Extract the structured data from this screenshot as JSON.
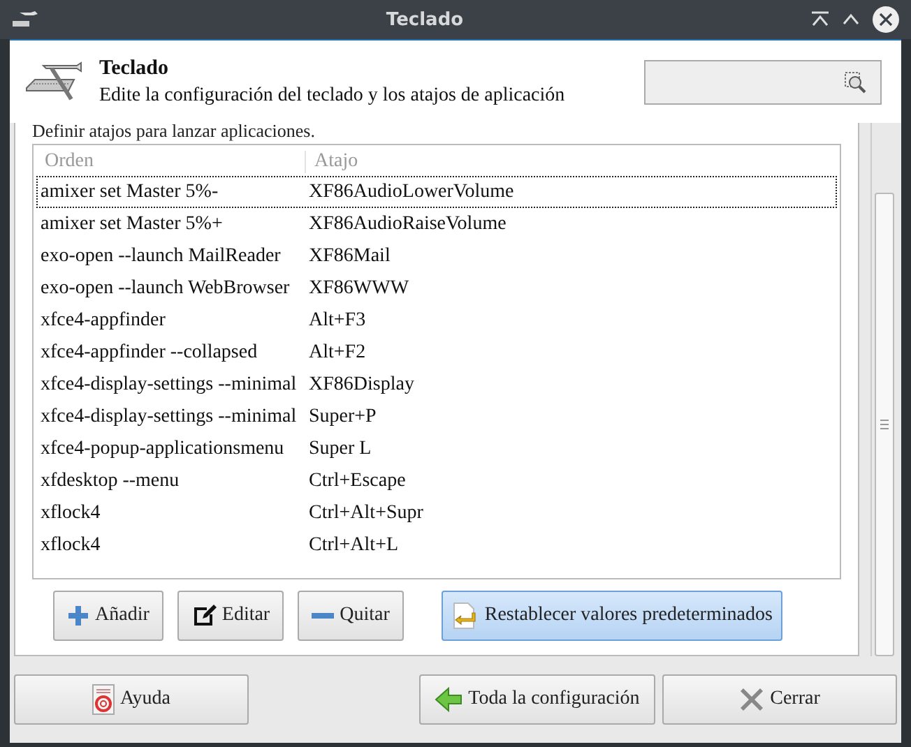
{
  "window": {
    "title": "Teclado"
  },
  "header": {
    "title": "Teclado",
    "subtitle": "Edite la configuración del teclado y los atajos de aplicación"
  },
  "section_label": "Definir atajos para lanzar aplicaciones.",
  "table": {
    "columns": [
      "Orden",
      "Atajo"
    ],
    "rows": [
      {
        "command": "amixer set Master 5%-",
        "shortcut": "XF86AudioLowerVolume",
        "focused": true
      },
      {
        "command": "amixer set Master 5%+",
        "shortcut": "XF86AudioRaiseVolume",
        "focused": false
      },
      {
        "command": "exo-open --launch MailReader",
        "shortcut": "XF86Mail",
        "focused": false
      },
      {
        "command": "exo-open --launch WebBrowser",
        "shortcut": "XF86WWW",
        "focused": false
      },
      {
        "command": "xfce4-appfinder",
        "shortcut": "Alt+F3",
        "focused": false
      },
      {
        "command": "xfce4-appfinder --collapsed",
        "shortcut": "Alt+F2",
        "focused": false
      },
      {
        "command": "xfce4-display-settings --minimal",
        "shortcut": "XF86Display",
        "focused": false
      },
      {
        "command": "xfce4-display-settings --minimal",
        "shortcut": "Super+P",
        "focused": false
      },
      {
        "command": "xfce4-popup-applicationsmenu",
        "shortcut": "Super L",
        "focused": false
      },
      {
        "command": "xfdesktop --menu",
        "shortcut": "Ctrl+Escape",
        "focused": false
      },
      {
        "command": "xflock4",
        "shortcut": "Ctrl+Alt+Supr",
        "focused": false
      },
      {
        "command": "xflock4",
        "shortcut": "Ctrl+Alt+L",
        "focused": false
      }
    ]
  },
  "table_buttons": [
    {
      "label": "Añadir",
      "kind": "add",
      "highlighted": false
    },
    {
      "label": "Editar",
      "kind": "edit",
      "highlighted": false
    },
    {
      "label": "Quitar",
      "kind": "remove",
      "highlighted": false
    },
    {
      "label": "Restablecer valores predeterminados",
      "kind": "reset",
      "highlighted": true
    }
  ],
  "dialog_buttons": [
    {
      "label": "Ayuda",
      "kind": "help"
    },
    {
      "label": "Toda la configuración",
      "kind": "back"
    },
    {
      "label": "Cerrar",
      "kind": "close"
    }
  ]
}
